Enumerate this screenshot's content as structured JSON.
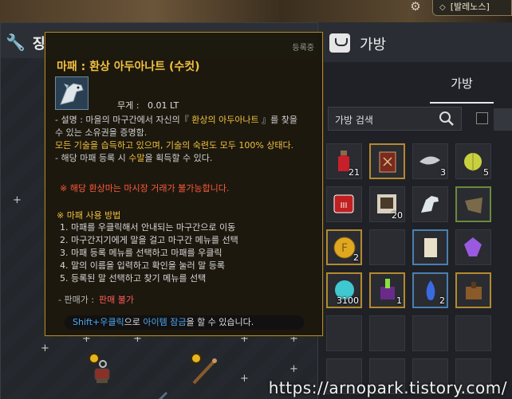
{
  "top_bar": {
    "gear_icon": "gear-icon",
    "server_label": "[발레노스]"
  },
  "left_panel": {
    "title_fragment": "장",
    "icon": "wrench-icon"
  },
  "bag": {
    "title": "가방",
    "tab_label": "가방",
    "search_placeholder": "가방 검색",
    "slots": [
      {
        "art": "potion",
        "qty": "21",
        "border": "none"
      },
      {
        "art": "book",
        "qty": "",
        "border": "gold"
      },
      {
        "art": "fish",
        "qty": "3",
        "border": "none"
      },
      {
        "art": "fruit",
        "qty": "5",
        "border": "none"
      },
      {
        "art": "scroll-red",
        "qty": "",
        "border": "none"
      },
      {
        "art": "stamp",
        "qty": "20",
        "border": "none"
      },
      {
        "art": "horse",
        "qty": "",
        "border": "none"
      },
      {
        "art": "hide",
        "qty": "",
        "border": "green"
      },
      {
        "art": "coin",
        "qty": "2",
        "border": "gold"
      },
      {
        "art": "empty",
        "qty": "",
        "border": "none"
      },
      {
        "art": "paper",
        "qty": "",
        "border": "blue"
      },
      {
        "art": "gem",
        "qty": "",
        "border": "none"
      },
      {
        "art": "orb",
        "qty": "3100",
        "border": "gold"
      },
      {
        "art": "box",
        "qty": "1",
        "border": "gold"
      },
      {
        "art": "fire",
        "qty": "2",
        "border": "blue"
      },
      {
        "art": "bundle",
        "qty": "",
        "border": "gold"
      }
    ]
  },
  "tooltip": {
    "registered": "등록중",
    "title": "마패 : 환상 아두아나트 (수컷)",
    "weight_label": "무게 :",
    "weight_value": "0.01 LT",
    "desc_line1_prefix": "- 설명 : 마을의 마구간에서 자신의『 ",
    "desc_line1_name": "환상의 아두아나트",
    "desc_line1_suffix": " 』를 찾을",
    "desc_line2": "수 있는 소유권을 증명함.",
    "desc_line3": "모든 기술을 습득하고 있으며, 기술의 숙련도 모두 100% 상태다.",
    "desc_line4_prefix": "- 해당 마패 등록 시 ",
    "desc_line4_name": "수말",
    "desc_line4_suffix": "을 획득할 수 있다.",
    "warning": "※ 해당 환상마는 마시장 거래가 불가능합니다.",
    "usage_title": "※ 마패 사용 방법",
    "usage_steps": [
      "1. 마패를 우클릭해서 안내되는 마구간으로 이동",
      "2. 마구간지기에게 말을 걸고 마구간 메뉴를 선택",
      "3. 마패 등록 메뉴를 선택하고 마패를 우클릭",
      "4. 말의 이름을 입력하고 확인을 눌러 말 등록",
      "5. 등록된 말 선택하고 찾기 메뉴를 선택"
    ],
    "seller_label": "- 판매가 :",
    "seller_value": "판매 불가",
    "hint_key": "Shift+우클릭",
    "hint_mid": "으로 ",
    "hint_link": "아이템 잠금",
    "hint_end": "을 할 수 있습니다."
  },
  "watermark": "https://arnopark.tistory.com/"
}
